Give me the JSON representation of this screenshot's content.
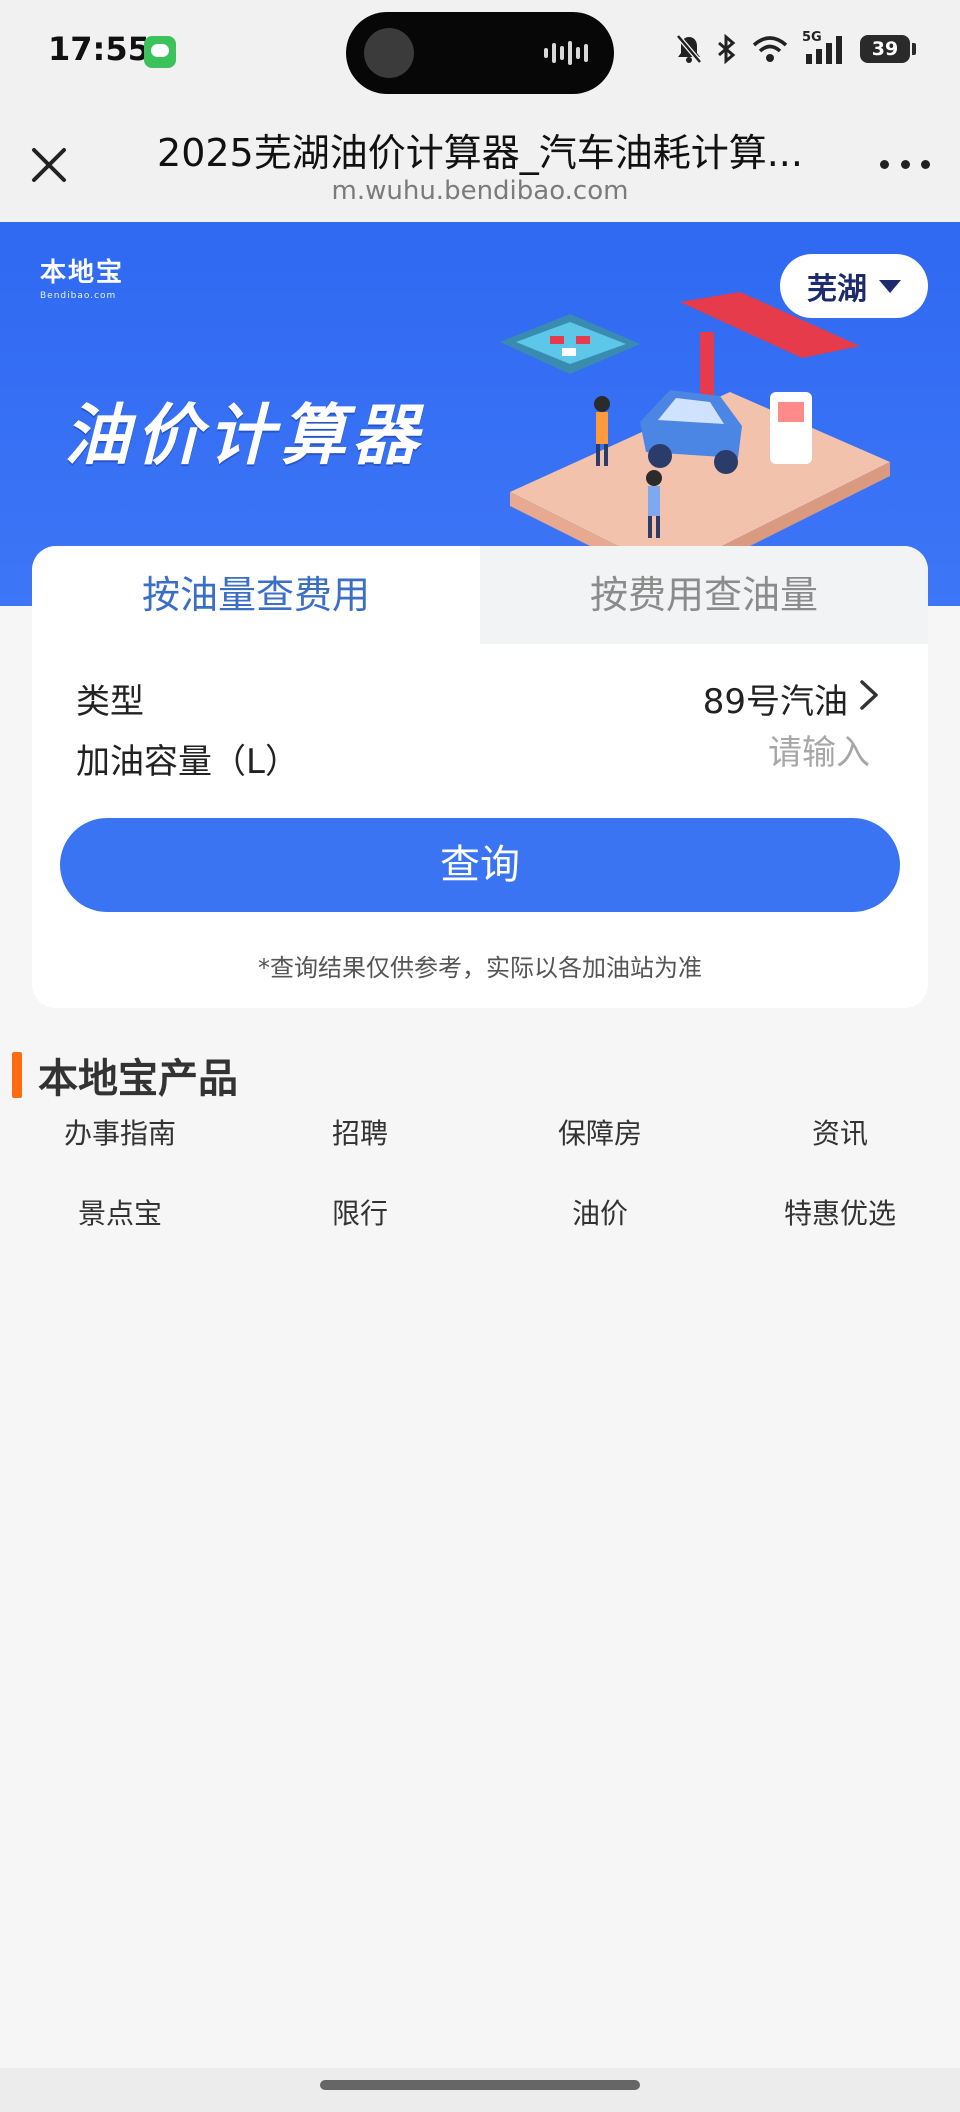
{
  "status_bar": {
    "time": "17:55",
    "network": "5G",
    "battery": "39"
  },
  "navbar": {
    "title": "2025芜湖油价计算器_汽车油耗计算...",
    "url": "m.wuhu.bendibao.com"
  },
  "banner": {
    "logo": "本地宝",
    "logo_sub": "Bendibao.com",
    "city": "芜湖",
    "title": "油价计算器",
    "primary_color": "#2f69f2"
  },
  "calculator": {
    "tabs": [
      {
        "label": "按油量查费用",
        "active": true
      },
      {
        "label": "按费用查油量",
        "active": false
      }
    ],
    "type_label": "类型",
    "type_value": "89号汽油",
    "volume_label": "加油容量（L）",
    "volume_placeholder": "请输入",
    "query_label": "查询",
    "note": "*查询结果仅供参考，实际以各加油站为准",
    "button_color": "#3a74f3"
  },
  "products": {
    "title": "本地宝产品",
    "accent_color": "#ff6a13",
    "items": [
      "办事指南",
      "招聘",
      "保障房",
      "资讯",
      "景点宝",
      "限行",
      "油价",
      "特惠优选"
    ]
  }
}
